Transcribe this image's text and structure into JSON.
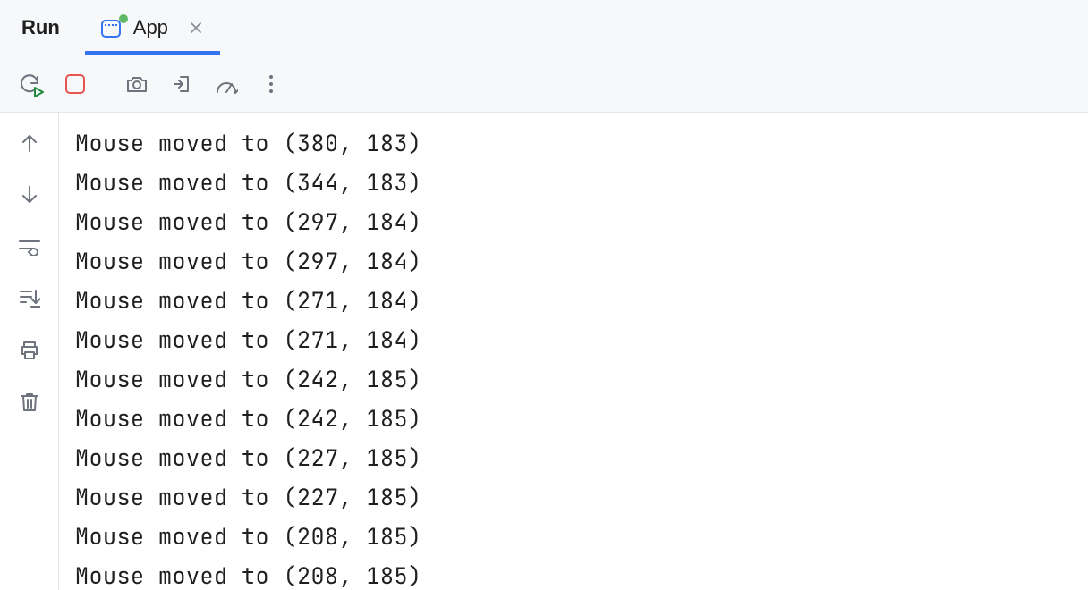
{
  "panel": {
    "title": "Run"
  },
  "tab": {
    "label": "App",
    "icon": "app-window-icon",
    "running": true
  },
  "toolbar": {
    "rerun_name": "rerun-button",
    "stop_name": "stop-button",
    "screenshot_name": "camera-icon",
    "exit_name": "exit-icon",
    "profiler_name": "gauge-icon",
    "overflow_name": "more-icon"
  },
  "gutter": {
    "up": "arrow-up-icon",
    "down": "arrow-down-icon",
    "wrap": "soft-wrap-icon",
    "scroll": "scroll-to-end-icon",
    "print": "print-icon",
    "trash": "trash-icon"
  },
  "console": {
    "lines": [
      "Mouse moved to (380, 183)",
      "Mouse moved to (344, 183)",
      "Mouse moved to (297, 184)",
      "Mouse moved to (297, 184)",
      "Mouse moved to (271, 184)",
      "Mouse moved to (271, 184)",
      "Mouse moved to (242, 185)",
      "Mouse moved to (242, 185)",
      "Mouse moved to (227, 185)",
      "Mouse moved to (227, 185)",
      "Mouse moved to (208, 185)",
      "Mouse moved to (208, 185)"
    ]
  }
}
